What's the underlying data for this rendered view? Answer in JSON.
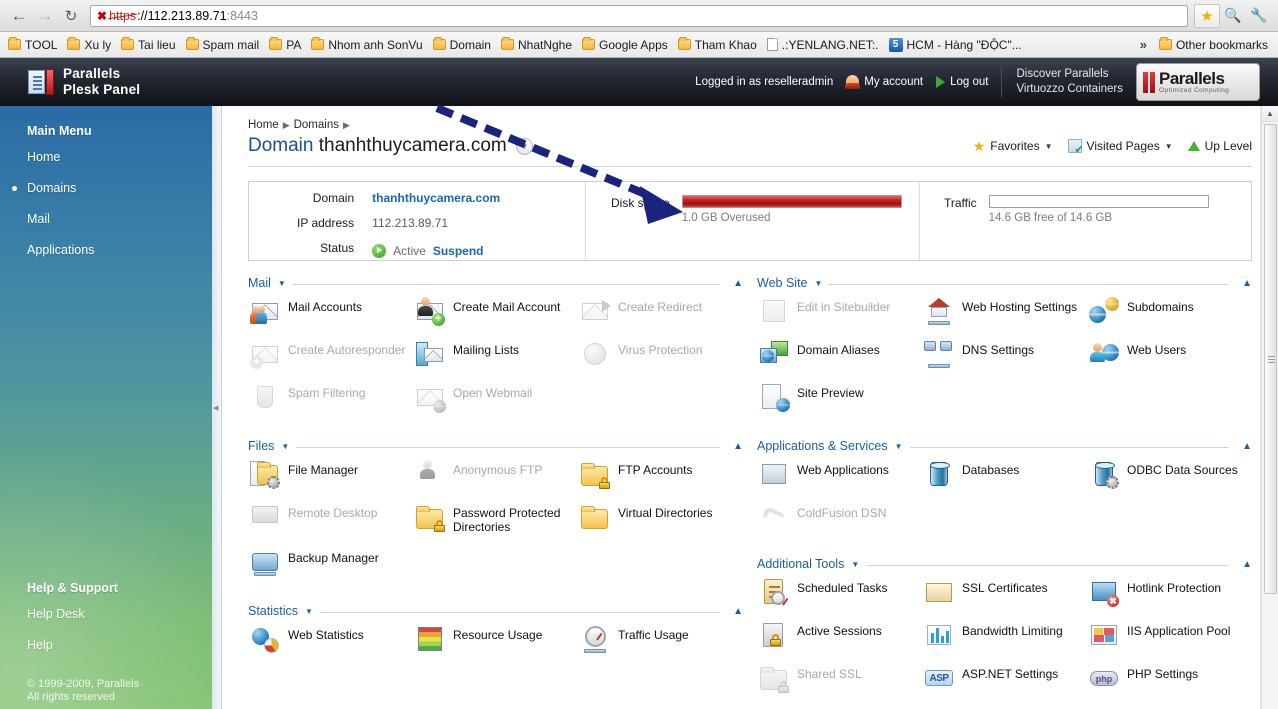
{
  "browser": {
    "back_icon": "back-arrow-icon",
    "forward_icon": "forward-arrow-icon",
    "reload_icon": "reload-icon",
    "url": {
      "scheme": "https",
      "separator": "://",
      "host": "112.213.89.71",
      "port": ":8443"
    },
    "ssl_warning_icon": "ssl-error-icon",
    "star_icon": "bookmark-star-icon",
    "zoom_icon": "zoom-icon",
    "wrench_icon": "wrench-menu-icon",
    "bookmarks": [
      {
        "label": "TOOL",
        "icon": "folder-icon"
      },
      {
        "label": "Xu ly",
        "icon": "folder-icon"
      },
      {
        "label": "Tai lieu",
        "icon": "folder-icon"
      },
      {
        "label": "Spam mail",
        "icon": "folder-icon"
      },
      {
        "label": "PA",
        "icon": "folder-icon"
      },
      {
        "label": "Nhom anh SonVu",
        "icon": "folder-icon"
      },
      {
        "label": "Domain",
        "icon": "folder-icon"
      },
      {
        "label": "NhatNghe",
        "icon": "folder-icon"
      },
      {
        "label": "Google Apps",
        "icon": "folder-icon"
      },
      {
        "label": "Tham Khao",
        "icon": "folder-icon"
      },
      {
        "label": ".:YENLANG.NET:.",
        "icon": "page-icon"
      },
      {
        "label": "HCM - Hàng \"ĐỘC\"...",
        "icon": "blue-five-icon"
      }
    ],
    "overflow_label": "»",
    "other_bookmarks": {
      "label": "Other bookmarks",
      "icon": "folder-icon"
    }
  },
  "header": {
    "product_line1": "Parallels",
    "product_line2": "Plesk Panel",
    "logged_in_as": "Logged in as reselleradmin",
    "my_account": "My account",
    "log_out": "Log out",
    "discover_line1": "Discover Parallels",
    "discover_line2": "Virtuozzo Containers",
    "brand_name": "Parallels",
    "brand_tagline": "Optimized Computing"
  },
  "sidebar": {
    "main_menu_title": "Main Menu",
    "items": [
      {
        "label": "Home",
        "active": false
      },
      {
        "label": "Domains",
        "active": true
      },
      {
        "label": "Mail",
        "active": false
      },
      {
        "label": "Applications",
        "active": false
      }
    ],
    "help_title": "Help & Support",
    "help_items": [
      {
        "label": "Help Desk"
      },
      {
        "label": "Help"
      }
    ],
    "copyright_line1": "© 1999-2009, Parallels",
    "copyright_line2": "All rights reserved"
  },
  "breadcrumb": {
    "home": "Home",
    "domains": "Domains"
  },
  "page": {
    "title_prefix": "Domain",
    "title_domain": "thanhthuycamera.com",
    "caret_icon": "chevron-down-circle-icon"
  },
  "toptools": {
    "favorites": "Favorites",
    "visited_pages": "Visited Pages",
    "up_level": "Up Level"
  },
  "summary": {
    "domain_label": "Domain",
    "domain_value": "thanhthuycamera.com",
    "ip_label": "IP address",
    "ip_value": "112.213.89.71",
    "status_label": "Status",
    "status_value": "Active",
    "suspend_link": "Suspend",
    "disk_label": "Disk space",
    "disk_caption": "1.0 GB Overused",
    "disk_percent": 100,
    "disk_color": "#c02020",
    "traffic_label": "Traffic",
    "traffic_caption": "14.6 GB free of 14.6 GB",
    "traffic_percent": 0
  },
  "sections": {
    "mail": {
      "title": "Mail",
      "items": [
        {
          "label": "Mail Accounts",
          "icon": "mail-accounts-icon",
          "disabled": false
        },
        {
          "label": "Create Mail Account",
          "icon": "create-mail-account-icon",
          "disabled": false
        },
        {
          "label": "Create Redirect",
          "icon": "create-redirect-icon",
          "disabled": true
        },
        {
          "label": "Create Autoresponder",
          "icon": "create-autoresponder-icon",
          "disabled": true
        },
        {
          "label": "Mailing Lists",
          "icon": "mailing-lists-icon",
          "disabled": false
        },
        {
          "label": "Virus Protection",
          "icon": "virus-protection-icon",
          "disabled": true
        },
        {
          "label": "Spam Filtering",
          "icon": "spam-filtering-icon",
          "disabled": true
        },
        {
          "label": "Open Webmail",
          "icon": "open-webmail-icon",
          "disabled": true
        }
      ]
    },
    "website": {
      "title": "Web Site",
      "items": [
        {
          "label": "Edit in Sitebuilder",
          "icon": "edit-in-sitebuilder-icon",
          "disabled": true
        },
        {
          "label": "Web Hosting Settings",
          "icon": "web-hosting-settings-icon",
          "disabled": false
        },
        {
          "label": "Subdomains",
          "icon": "subdomains-icon",
          "disabled": false
        },
        {
          "label": "Domain Aliases",
          "icon": "domain-aliases-icon",
          "disabled": false
        },
        {
          "label": "DNS Settings",
          "icon": "dns-settings-icon",
          "disabled": false
        },
        {
          "label": "Web Users",
          "icon": "web-users-icon",
          "disabled": false
        },
        {
          "label": "Site Preview",
          "icon": "site-preview-icon",
          "disabled": false
        }
      ]
    },
    "files": {
      "title": "Files",
      "items": [
        {
          "label": "File Manager",
          "icon": "file-manager-icon",
          "disabled": false
        },
        {
          "label": "Anonymous FTP",
          "icon": "anonymous-ftp-icon",
          "disabled": true
        },
        {
          "label": "FTP Accounts",
          "icon": "ftp-accounts-icon",
          "disabled": false
        },
        {
          "label": "Remote Desktop",
          "icon": "remote-desktop-icon",
          "disabled": true
        },
        {
          "label": "Password Protected Directories",
          "icon": "password-protected-directories-icon",
          "disabled": false
        },
        {
          "label": "Virtual Directories",
          "icon": "virtual-directories-icon",
          "disabled": false
        },
        {
          "label": "Backup Manager",
          "icon": "backup-manager-icon",
          "disabled": false
        }
      ]
    },
    "apps": {
      "title": "Applications & Services",
      "items": [
        {
          "label": "Web Applications",
          "icon": "web-applications-icon",
          "disabled": false
        },
        {
          "label": "Databases",
          "icon": "databases-icon",
          "disabled": false
        },
        {
          "label": "ODBC Data Sources",
          "icon": "odbc-data-sources-icon",
          "disabled": false
        },
        {
          "label": "ColdFusion DSN",
          "icon": "coldfusion-dsn-icon",
          "disabled": true
        }
      ]
    },
    "statistics": {
      "title": "Statistics",
      "items": [
        {
          "label": "Web Statistics",
          "icon": "web-statistics-icon",
          "disabled": false
        },
        {
          "label": "Resource Usage",
          "icon": "resource-usage-icon",
          "disabled": false
        },
        {
          "label": "Traffic Usage",
          "icon": "traffic-usage-icon",
          "disabled": false
        }
      ]
    },
    "additional": {
      "title": "Additional Tools",
      "items": [
        {
          "label": "Scheduled Tasks",
          "icon": "scheduled-tasks-icon",
          "disabled": false
        },
        {
          "label": "SSL Certificates",
          "icon": "ssl-certificates-icon",
          "disabled": false
        },
        {
          "label": "Hotlink Protection",
          "icon": "hotlink-protection-icon",
          "disabled": false
        },
        {
          "label": "Active Sessions",
          "icon": "active-sessions-icon",
          "disabled": false
        },
        {
          "label": "Bandwidth Limiting",
          "icon": "bandwidth-limiting-icon",
          "disabled": false
        },
        {
          "label": "IIS Application Pool",
          "icon": "iis-application-pool-icon",
          "disabled": false
        },
        {
          "label": "Shared SSL",
          "icon": "shared-ssl-icon",
          "disabled": true
        },
        {
          "label": "ASP.NET Settings",
          "icon": "asp-net-settings-icon",
          "disabled": false
        },
        {
          "label": "PHP Settings",
          "icon": "php-settings-icon",
          "disabled": false
        }
      ]
    }
  },
  "annotation": {
    "type": "dashed-arrow",
    "color": "#1a237e",
    "points_to": "disk-space-meter"
  }
}
